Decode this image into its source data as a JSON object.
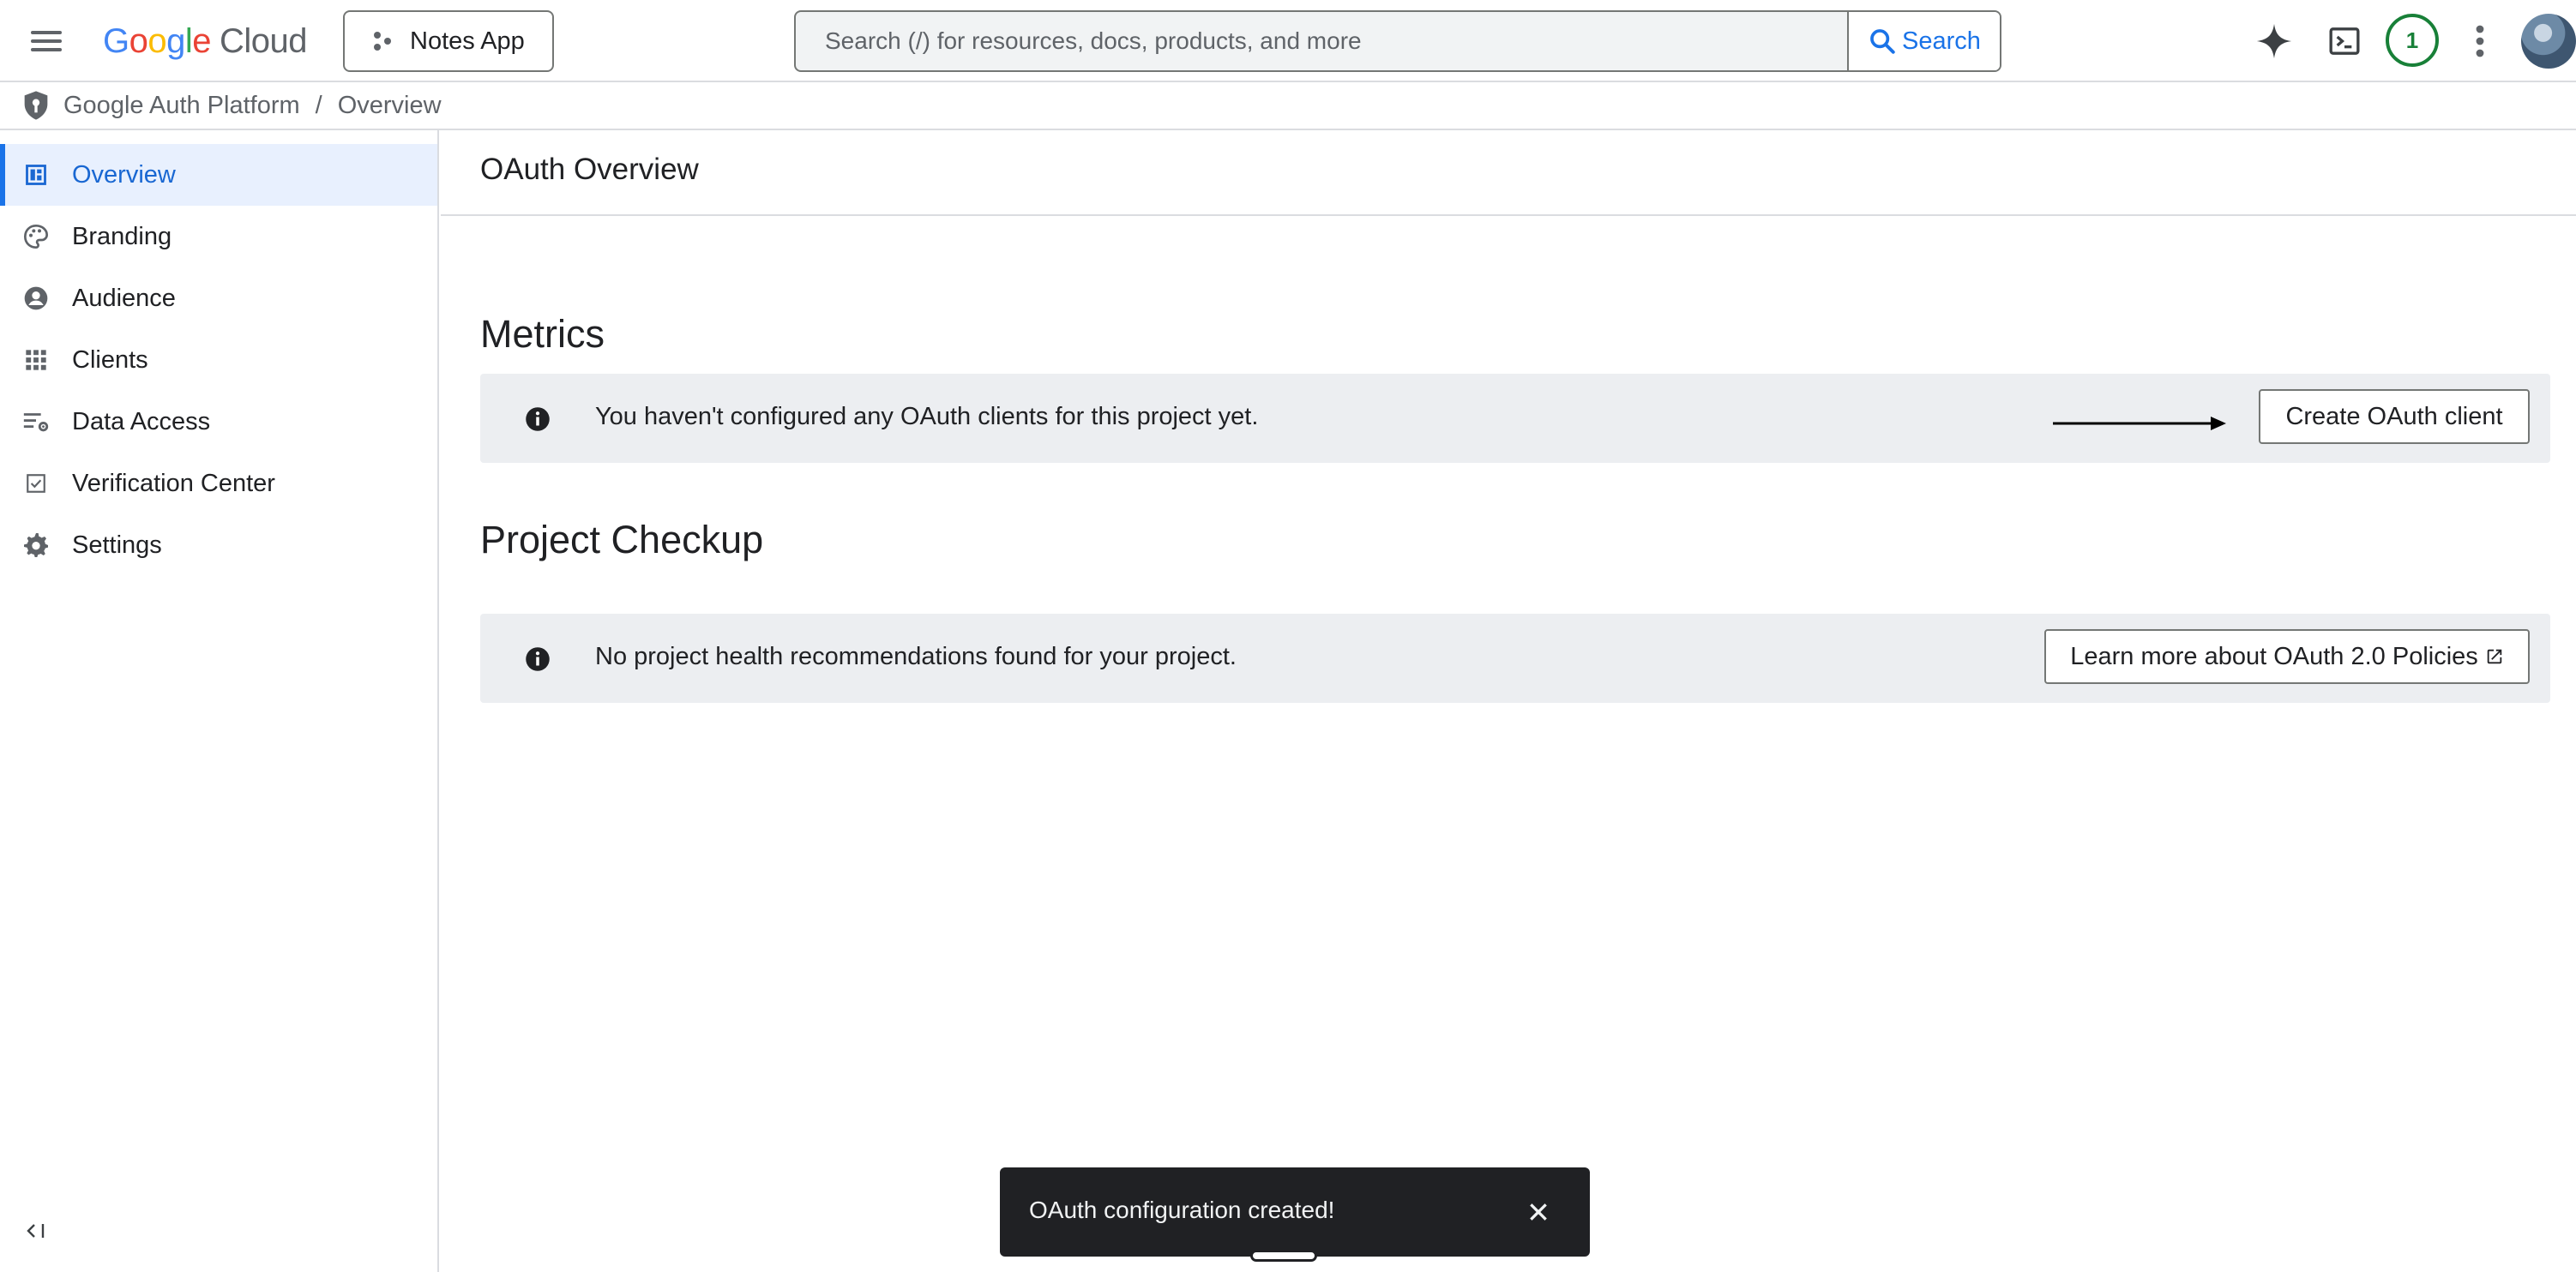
{
  "topbar": {
    "menu_icon": "hamburger-menu-icon",
    "logo": {
      "letters": [
        "G",
        "o",
        "o",
        "g",
        "l",
        "e"
      ],
      "suffix": "Cloud"
    },
    "project_label": "Notes App",
    "search_placeholder": "Search (/) for resources, docs, products, and more",
    "search_button_label": "Search",
    "notification_count": "1",
    "icons": [
      "gemini-sparkle-icon",
      "cloud-shell-terminal-icon",
      "more-vert-icon",
      "avatar"
    ]
  },
  "breadcrumb": {
    "items": [
      "Google Auth Platform",
      "Overview"
    ],
    "separator": "/"
  },
  "sidebar": {
    "items": [
      {
        "label": "Overview",
        "icon": "dashboard-icon",
        "active": true
      },
      {
        "label": "Branding",
        "icon": "palette-icon"
      },
      {
        "label": "Audience",
        "icon": "account-circle-icon"
      },
      {
        "label": "Clients",
        "icon": "apps-grid-icon"
      },
      {
        "label": "Data Access",
        "icon": "filter-settings-icon"
      },
      {
        "label": "Verification Center",
        "icon": "checkbox-icon"
      },
      {
        "label": "Settings",
        "icon": "gear-icon"
      }
    ],
    "collapse_label": "<|"
  },
  "main": {
    "page_title": "OAuth Overview",
    "metrics": {
      "title": "Metrics",
      "message": "You haven't configured any OAuth clients for this project yet.",
      "button_label": "Create OAuth client"
    },
    "checkup": {
      "title": "Project Checkup",
      "message": "No project health recommendations found for your project.",
      "button_label": "Learn more about OAuth 2.0 Policies"
    }
  },
  "snackbar": {
    "message": "OAuth configuration created!"
  },
  "colors": {
    "accent": "#1a73e8",
    "active_bg": "#e8f0fe",
    "card_bg": "#eceef1",
    "badge_green": "#188038"
  }
}
